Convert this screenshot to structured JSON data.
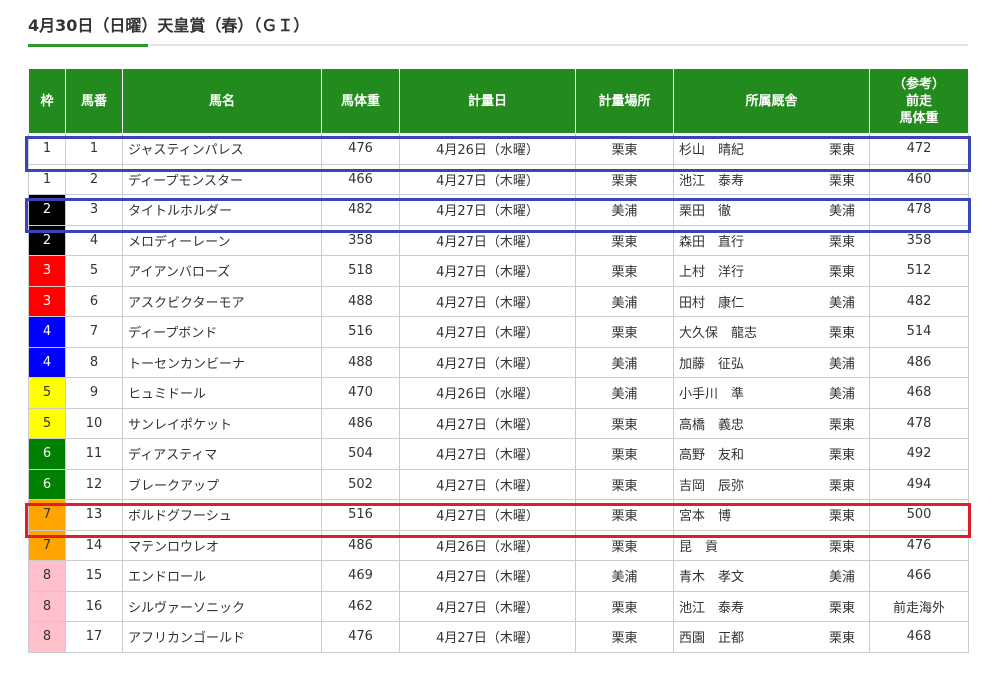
{
  "page": {
    "title": "4月30日（日曜）天皇賞（春）（ＧＩ）"
  },
  "table": {
    "headers": {
      "waku": "枠",
      "umaban": "馬番",
      "name": "馬名",
      "weight": "馬体重",
      "date": "計量日",
      "place": "計量場所",
      "stable": "所属厩舎",
      "prev_1": "（参考）",
      "prev_2": "前走",
      "prev_3": "馬体重"
    },
    "rows": [
      {
        "waku": "1",
        "umaban": "1",
        "name": "ジャスティンパレス",
        "weight": "476",
        "date": "4月26日（水曜）",
        "place": "栗東",
        "trainer": "杉山　晴紀",
        "region": "栗東",
        "prev": "472"
      },
      {
        "waku": "1",
        "umaban": "2",
        "name": "ディープモンスター",
        "weight": "466",
        "date": "4月27日（木曜）",
        "place": "栗東",
        "trainer": "池江　泰寿",
        "region": "栗東",
        "prev": "460"
      },
      {
        "waku": "2",
        "umaban": "3",
        "name": "タイトルホルダー",
        "weight": "482",
        "date": "4月27日（木曜）",
        "place": "美浦",
        "trainer": "栗田　徹",
        "region": "美浦",
        "prev": "478"
      },
      {
        "waku": "2",
        "umaban": "4",
        "name": "メロディーレーン",
        "weight": "358",
        "date": "4月27日（木曜）",
        "place": "栗東",
        "trainer": "森田　直行",
        "region": "栗東",
        "prev": "358"
      },
      {
        "waku": "3",
        "umaban": "5",
        "name": "アイアンバローズ",
        "weight": "518",
        "date": "4月27日（木曜）",
        "place": "栗東",
        "trainer": "上村　洋行",
        "region": "栗東",
        "prev": "512"
      },
      {
        "waku": "3",
        "umaban": "6",
        "name": "アスクビクターモア",
        "weight": "488",
        "date": "4月27日（木曜）",
        "place": "美浦",
        "trainer": "田村　康仁",
        "region": "美浦",
        "prev": "482"
      },
      {
        "waku": "4",
        "umaban": "7",
        "name": "ディープボンド",
        "weight": "516",
        "date": "4月27日（木曜）",
        "place": "栗東",
        "trainer": "大久保　龍志",
        "region": "栗東",
        "prev": "514"
      },
      {
        "waku": "4",
        "umaban": "8",
        "name": "トーセンカンビーナ",
        "weight": "488",
        "date": "4月27日（木曜）",
        "place": "美浦",
        "trainer": "加藤　征弘",
        "region": "美浦",
        "prev": "486"
      },
      {
        "waku": "5",
        "umaban": "9",
        "name": "ヒュミドール",
        "weight": "470",
        "date": "4月26日（水曜）",
        "place": "美浦",
        "trainer": "小手川　準",
        "region": "美浦",
        "prev": "468"
      },
      {
        "waku": "5",
        "umaban": "10",
        "name": "サンレイポケット",
        "weight": "486",
        "date": "4月27日（木曜）",
        "place": "栗東",
        "trainer": "高橋　義忠",
        "region": "栗東",
        "prev": "478"
      },
      {
        "waku": "6",
        "umaban": "11",
        "name": "ディアスティマ",
        "weight": "504",
        "date": "4月27日（木曜）",
        "place": "栗東",
        "trainer": "高野　友和",
        "region": "栗東",
        "prev": "492"
      },
      {
        "waku": "6",
        "umaban": "12",
        "name": "ブレークアップ",
        "weight": "502",
        "date": "4月27日（木曜）",
        "place": "栗東",
        "trainer": "吉岡　辰弥",
        "region": "栗東",
        "prev": "494"
      },
      {
        "waku": "7",
        "umaban": "13",
        "name": "ボルドグフーシュ",
        "weight": "516",
        "date": "4月27日（木曜）",
        "place": "栗東",
        "trainer": "宮本　博",
        "region": "栗東",
        "prev": "500"
      },
      {
        "waku": "7",
        "umaban": "14",
        "name": "マテンロウレオ",
        "weight": "486",
        "date": "4月26日（水曜）",
        "place": "栗東",
        "trainer": "昆　貢",
        "region": "栗東",
        "prev": "476"
      },
      {
        "waku": "8",
        "umaban": "15",
        "name": "エンドロール",
        "weight": "469",
        "date": "4月27日（木曜）",
        "place": "美浦",
        "trainer": "青木　孝文",
        "region": "美浦",
        "prev": "466"
      },
      {
        "waku": "8",
        "umaban": "16",
        "name": "シルヴァーソニック",
        "weight": "462",
        "date": "4月27日（木曜）",
        "place": "栗東",
        "trainer": "池江　泰寿",
        "region": "栗東",
        "prev": "前走海外"
      },
      {
        "waku": "8",
        "umaban": "17",
        "name": "アフリカンゴールド",
        "weight": "476",
        "date": "4月27日（木曜）",
        "place": "栗東",
        "trainer": "西園　正都",
        "region": "栗東",
        "prev": "468"
      }
    ]
  },
  "colors": {
    "header_bg": "#238a1e",
    "highlight_blue": "#3a44b8",
    "highlight_red": "#e01e2a",
    "waku_1": "#ffffff",
    "waku_2": "#000000",
    "waku_3": "#ff0000",
    "waku_4": "#0000ff",
    "waku_5": "#ffff00",
    "waku_6": "#008000",
    "waku_7": "#ffa500",
    "waku_8": "#ffc0cb"
  }
}
